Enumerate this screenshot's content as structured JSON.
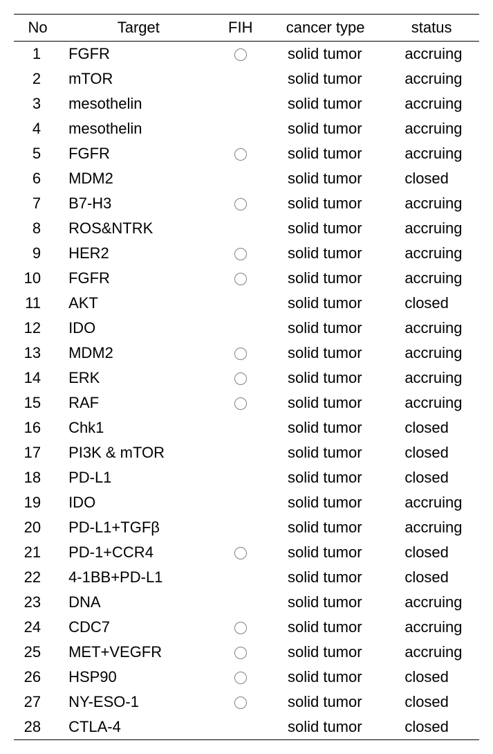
{
  "headers": {
    "no": "No",
    "target": "Target",
    "fih": "FIH",
    "cancer_type": "cancer type",
    "status": "status"
  },
  "rows": [
    {
      "no": "1",
      "target": "FGFR",
      "fih": true,
      "cancer_type": "solid tumor",
      "status": "accruing"
    },
    {
      "no": "2",
      "target": "mTOR",
      "fih": false,
      "cancer_type": "solid tumor",
      "status": "accruing"
    },
    {
      "no": "3",
      "target": "mesothelin",
      "fih": false,
      "cancer_type": "solid tumor",
      "status": "accruing"
    },
    {
      "no": "4",
      "target": "mesothelin",
      "fih": false,
      "cancer_type": "solid tumor",
      "status": "accruing"
    },
    {
      "no": "5",
      "target": "FGFR",
      "fih": true,
      "cancer_type": "solid tumor",
      "status": "accruing"
    },
    {
      "no": "6",
      "target": "MDM2",
      "fih": false,
      "cancer_type": "solid tumor",
      "status": "closed"
    },
    {
      "no": "7",
      "target": "B7-H3",
      "fih": true,
      "cancer_type": "solid tumor",
      "status": "accruing"
    },
    {
      "no": "8",
      "target": "ROS&NTRK",
      "fih": false,
      "cancer_type": "solid tumor",
      "status": "accruing"
    },
    {
      "no": "9",
      "target": "HER2",
      "fih": true,
      "cancer_type": "solid tumor",
      "status": "accruing"
    },
    {
      "no": "10",
      "target": "FGFR",
      "fih": true,
      "cancer_type": "solid tumor",
      "status": "accruing"
    },
    {
      "no": "11",
      "target": "AKT",
      "fih": false,
      "cancer_type": "solid tumor",
      "status": "closed"
    },
    {
      "no": "12",
      "target": "IDO",
      "fih": false,
      "cancer_type": "solid tumor",
      "status": "accruing"
    },
    {
      "no": "13",
      "target": "MDM2",
      "fih": true,
      "cancer_type": "solid tumor",
      "status": "accruing"
    },
    {
      "no": "14",
      "target": "ERK",
      "fih": true,
      "cancer_type": "solid tumor",
      "status": "accruing"
    },
    {
      "no": "15",
      "target": "RAF",
      "fih": true,
      "cancer_type": "solid tumor",
      "status": "accruing"
    },
    {
      "no": "16",
      "target": "Chk1",
      "fih": false,
      "cancer_type": "solid tumor",
      "status": "closed"
    },
    {
      "no": "17",
      "target": "PI3K & mTOR",
      "fih": false,
      "cancer_type": "solid tumor",
      "status": "closed"
    },
    {
      "no": "18",
      "target": "PD-L1",
      "fih": false,
      "cancer_type": "solid tumor",
      "status": "closed"
    },
    {
      "no": "19",
      "target": "IDO",
      "fih": false,
      "cancer_type": "solid tumor",
      "status": "accruing"
    },
    {
      "no": "20",
      "target": "PD-L1+TGFβ",
      "fih": false,
      "cancer_type": "solid tumor",
      "status": "accruing"
    },
    {
      "no": "21",
      "target": "PD-1+CCR4",
      "fih": true,
      "cancer_type": "solid tumor",
      "status": "closed"
    },
    {
      "no": "22",
      "target": "4-1BB+PD-L1",
      "fih": false,
      "cancer_type": "solid tumor",
      "status": "closed"
    },
    {
      "no": "23",
      "target": "DNA",
      "fih": false,
      "cancer_type": "solid tumor",
      "status": "accruing"
    },
    {
      "no": "24",
      "target": "CDC7",
      "fih": true,
      "cancer_type": "solid tumor",
      "status": "accruing"
    },
    {
      "no": "25",
      "target": "MET+VEGFR",
      "fih": true,
      "cancer_type": "solid tumor",
      "status": "accruing"
    },
    {
      "no": "26",
      "target": "HSP90",
      "fih": true,
      "cancer_type": "solid tumor",
      "status": "closed"
    },
    {
      "no": "27",
      "target": "NY-ESO-1",
      "fih": true,
      "cancer_type": "solid tumor",
      "status": "closed"
    },
    {
      "no": "28",
      "target": "CTLA-4",
      "fih": false,
      "cancer_type": "solid tumor",
      "status": "closed"
    }
  ]
}
